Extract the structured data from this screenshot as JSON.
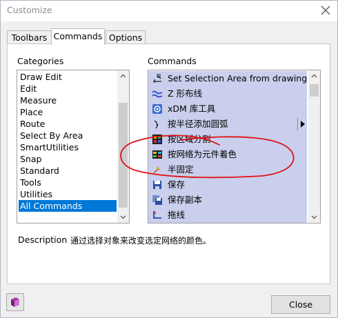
{
  "window": {
    "title": "Customize"
  },
  "tabs": [
    {
      "label": "Toolbars",
      "active": false
    },
    {
      "label": "Commands",
      "active": true
    },
    {
      "label": "Options",
      "active": false
    }
  ],
  "categories": {
    "label": "Categories",
    "items": [
      "Draw Edit",
      "Edit",
      "Measure",
      "Place",
      "Route",
      "Select By Area",
      "SmartUtilities",
      "Snap",
      "Standard",
      "Tools",
      "Utilities",
      "All Commands"
    ],
    "selected": "All Commands"
  },
  "commands": {
    "label": "Commands",
    "items": [
      {
        "label": "Set Selection Area from drawing",
        "icon": "selection-area-icon"
      },
      {
        "label": "Z 形布线",
        "icon": "z-route-icon"
      },
      {
        "label": "xDM 库工具",
        "icon": "xdm-library-icon"
      },
      {
        "label": "按半径添加圆弧",
        "icon": "arc-radius-icon",
        "has_submenu": true
      },
      {
        "label": "按区域分割",
        "icon": "area-split-icon"
      },
      {
        "label": "按网络为元件着色",
        "icon": "net-color-icon"
      },
      {
        "label": "半固定",
        "icon": "semi-fixed-icon"
      },
      {
        "label": "保存",
        "icon": "save-icon"
      },
      {
        "label": "保存副本",
        "icon": "save-copy-icon"
      },
      {
        "label": "拖线",
        "icon": "drag-track-icon"
      }
    ]
  },
  "description": {
    "label": "Description",
    "value": "通过选择对象来改变选定网络的颜色。"
  },
  "buttons": {
    "close": "Close"
  },
  "colors": {
    "selection": "#0078d7",
    "command_highlight": "#c9cfec",
    "annotation": "#e01010"
  }
}
